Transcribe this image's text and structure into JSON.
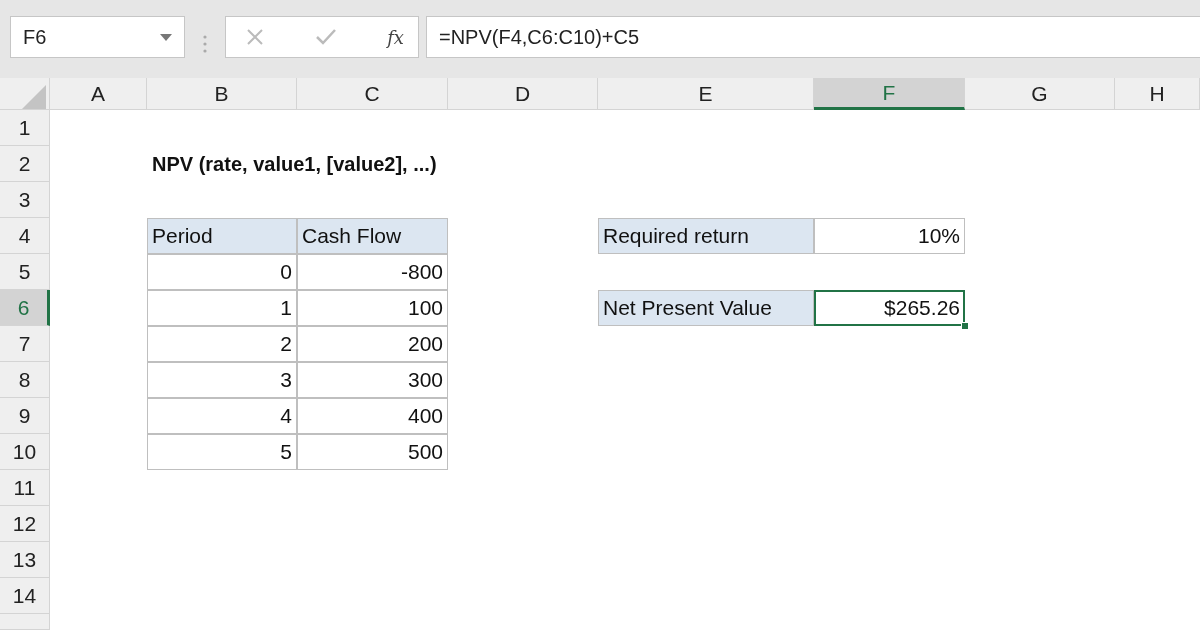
{
  "name_box": {
    "value": "F6"
  },
  "formula_bar": {
    "function_label": "fx",
    "formula": "=NPV(F4,C6:C10)+C5"
  },
  "columns": [
    {
      "label": "A",
      "selected": false
    },
    {
      "label": "B",
      "selected": false
    },
    {
      "label": "C",
      "selected": false
    },
    {
      "label": "D",
      "selected": false
    },
    {
      "label": "E",
      "selected": false
    },
    {
      "label": "F",
      "selected": true
    },
    {
      "label": "G",
      "selected": false
    },
    {
      "label": "H",
      "selected": false
    }
  ],
  "rows": [
    {
      "label": "1",
      "selected": false
    },
    {
      "label": "2",
      "selected": false,
      "cells": {
        "B": {
          "kind": "title",
          "text": "NPV (rate, value1, [value2], ...)",
          "selected": false
        }
      }
    },
    {
      "label": "3",
      "selected": false
    },
    {
      "label": "4",
      "selected": false,
      "cells": {
        "B": {
          "kind": "header",
          "text": "Period",
          "selected": false
        },
        "C": {
          "kind": "header",
          "text": "Cash Flow",
          "selected": false
        },
        "E": {
          "kind": "header",
          "text": "Required return",
          "selected": false
        },
        "F": {
          "kind": "number",
          "text": "10%",
          "selected": false
        }
      }
    },
    {
      "label": "5",
      "selected": false,
      "cells": {
        "B": {
          "kind": "number",
          "text": "0",
          "selected": false
        },
        "C": {
          "kind": "number",
          "text": "-800",
          "selected": false
        }
      }
    },
    {
      "label": "6",
      "selected": true,
      "cells": {
        "B": {
          "kind": "number",
          "text": "1",
          "selected": false
        },
        "C": {
          "kind": "number",
          "text": "100",
          "selected": false
        },
        "E": {
          "kind": "header",
          "text": "Net Present Value",
          "selected": false
        },
        "F": {
          "kind": "number",
          "text": "$265.26",
          "selected": true
        }
      }
    },
    {
      "label": "7",
      "selected": false,
      "cells": {
        "B": {
          "kind": "number",
          "text": "2",
          "selected": false
        },
        "C": {
          "kind": "number",
          "text": "200",
          "selected": false
        }
      }
    },
    {
      "label": "8",
      "selected": false,
      "cells": {
        "B": {
          "kind": "number",
          "text": "3",
          "selected": false
        },
        "C": {
          "kind": "number",
          "text": "300",
          "selected": false
        }
      }
    },
    {
      "label": "9",
      "selected": false,
      "cells": {
        "B": {
          "kind": "number",
          "text": "4",
          "selected": false
        },
        "C": {
          "kind": "number",
          "text": "400",
          "selected": false
        }
      }
    },
    {
      "label": "10",
      "selected": false,
      "cells": {
        "B": {
          "kind": "number",
          "text": "5",
          "selected": false
        },
        "C": {
          "kind": "number",
          "text": "500",
          "selected": false
        }
      }
    },
    {
      "label": "11",
      "selected": false
    },
    {
      "label": "12",
      "selected": false
    },
    {
      "label": "13",
      "selected": false
    },
    {
      "label": "14",
      "selected": false
    }
  ]
}
